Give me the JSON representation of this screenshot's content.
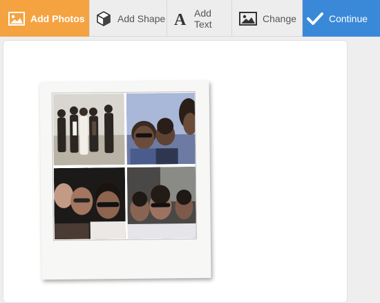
{
  "toolbar": {
    "items": [
      {
        "label": "Add Photos",
        "icon": "image-icon",
        "state": "active"
      },
      {
        "label": "Add Shape",
        "icon": "cube-icon",
        "state": "default"
      },
      {
        "label": "Add Text",
        "icon": "text-a-icon",
        "state": "default"
      },
      {
        "label": "Change",
        "icon": "image-icon",
        "state": "default"
      },
      {
        "label": "Continue",
        "icon": "checkmark-icon",
        "state": "primary"
      }
    ]
  },
  "colors": {
    "active": "#f5a341",
    "primary": "#3a89d8",
    "toolbar_bg": "#ededed",
    "canvas_bg": "#ffffff"
  },
  "canvas": {
    "frame": "polaroid",
    "photos": [
      {
        "subject": "group of six young men standing outdoors"
      },
      {
        "subject": "two young men selfie with sunglasses"
      },
      {
        "subject": "group selfie with glasses"
      },
      {
        "subject": "three young men selfie with glasses"
      }
    ]
  }
}
